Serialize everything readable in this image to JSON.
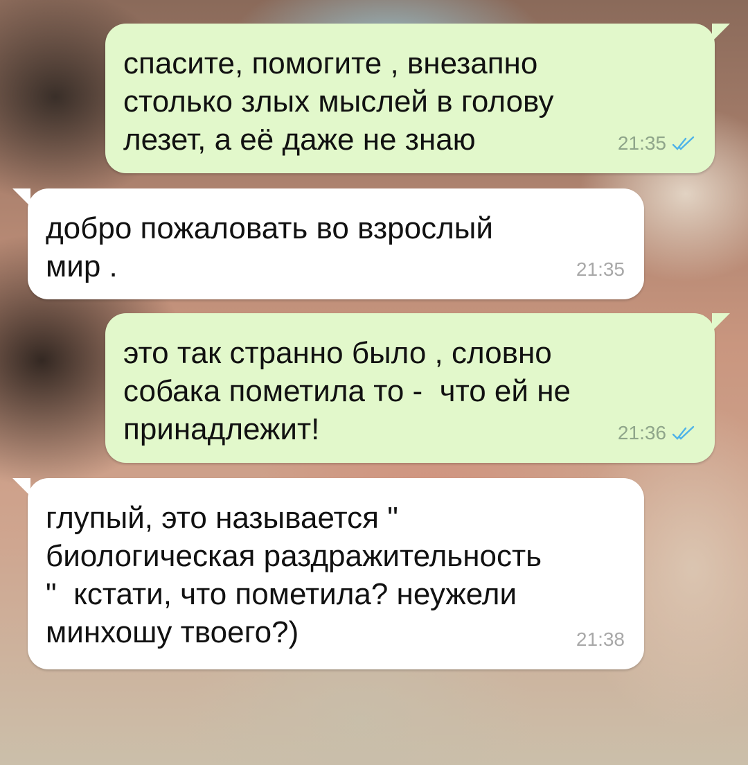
{
  "messages": [
    {
      "direction": "outgoing",
      "text": "спасите, помогите , внезапно\nстолько злых мыслей в голову\nлезет, а её даже не знаю",
      "time": "21:35",
      "status_icon": "double-check-read-icon"
    },
    {
      "direction": "incoming",
      "text": "добро пожаловать во взрослый\nмир .",
      "time": "21:35"
    },
    {
      "direction": "outgoing",
      "text": "это так странно было , словно\nсобака пометила то -  что ей не\nпринадлежит!",
      "time": "21:36",
      "status_icon": "double-check-read-icon"
    },
    {
      "direction": "incoming",
      "text": "глупый, это называется \"\nбиологическая раздражительность\n\"  кстати, что пометила? неужели\nминхошу твоего?)",
      "time": "21:38"
    }
  ],
  "colors": {
    "outgoing_bubble": "#e2f8cb",
    "incoming_bubble": "#ffffff",
    "read_ticks": "#4fb3e8"
  }
}
